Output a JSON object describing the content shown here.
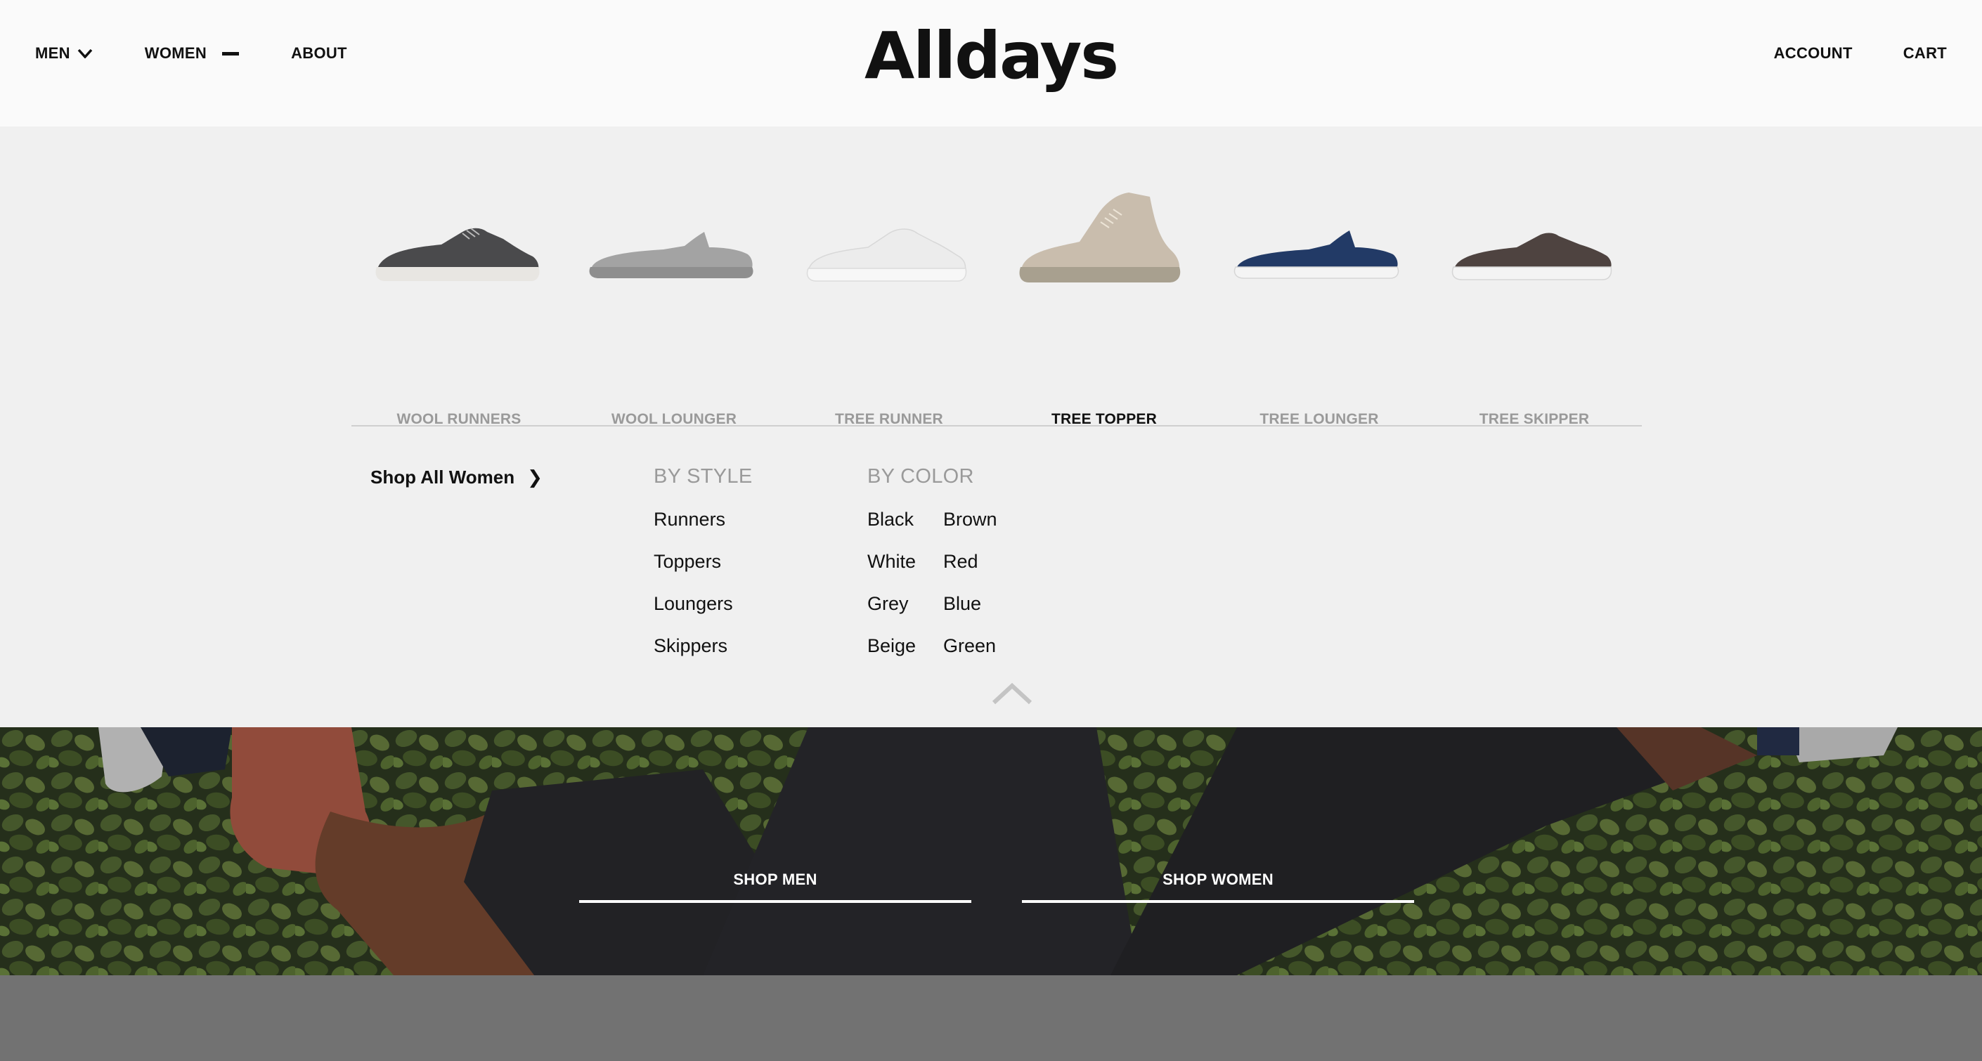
{
  "header": {
    "logo": "Alldays",
    "nav_left": [
      {
        "label": "MEN",
        "indicator": "chevron-down"
      },
      {
        "label": "WOMEN",
        "indicator": "minus"
      },
      {
        "label": "ABOUT"
      }
    ],
    "nav_right": [
      {
        "label": "ACCOUNT"
      },
      {
        "label": "CART"
      }
    ]
  },
  "mega_menu": {
    "products": [
      {
        "name": "WOOL RUNNERS",
        "color": "#4a4a4c",
        "active": false
      },
      {
        "name": "WOOL LOUNGER",
        "color": "#a3a3a3",
        "active": false
      },
      {
        "name": "TREE RUNNER",
        "color": "#ececec",
        "active": false
      },
      {
        "name": "TREE TOPPER",
        "color": "#c9bdad",
        "active": true
      },
      {
        "name": "TREE LOUNGER",
        "color": "#223a66",
        "active": false
      },
      {
        "name": "TREE SKIPPER",
        "color": "#4e4340",
        "active": false
      }
    ],
    "shop_all": {
      "label": "Shop All Women",
      "arrow": "❯"
    },
    "by_style": {
      "heading": "BY STYLE",
      "items": [
        "Runners",
        "Toppers",
        "Loungers",
        "Skippers"
      ]
    },
    "by_color": {
      "heading": "BY COLOR",
      "col1": [
        "Black",
        "White",
        "Grey",
        "Beige"
      ],
      "col2": [
        "Brown",
        "Red",
        "Blue",
        "Green"
      ]
    }
  },
  "hero": {
    "buttons": [
      {
        "label": "SHOP MEN"
      },
      {
        "label": "SHOP WOMEN"
      }
    ]
  },
  "colors": {
    "header_bg": "#fafafa",
    "menu_bg": "#f0f0f0",
    "muted_text": "#9a9a9a",
    "footer_bg": "#727272"
  }
}
